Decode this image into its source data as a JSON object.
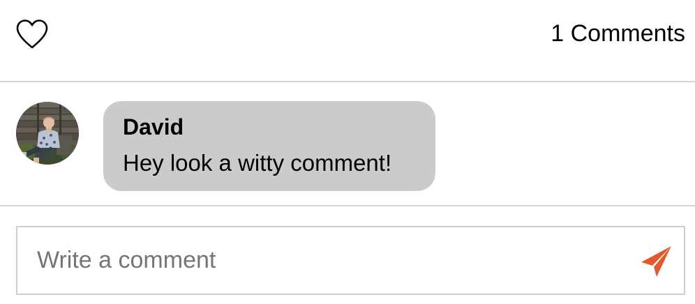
{
  "post_actions": {
    "like_icon": "heart-outline-icon",
    "comment_count_label": "1 Comments"
  },
  "comments": [
    {
      "avatar_icon": "user-avatar-photo",
      "author": "David",
      "text": "Hey look a witty comment!"
    }
  ],
  "comment_form": {
    "placeholder": "Write a comment",
    "value": "",
    "send_icon": "paper-plane-icon",
    "send_color": "#e05a2b"
  },
  "colors": {
    "bubble_background": "#cbcbcb",
    "divider": "#d4d4d4",
    "placeholder_text": "#757575"
  }
}
